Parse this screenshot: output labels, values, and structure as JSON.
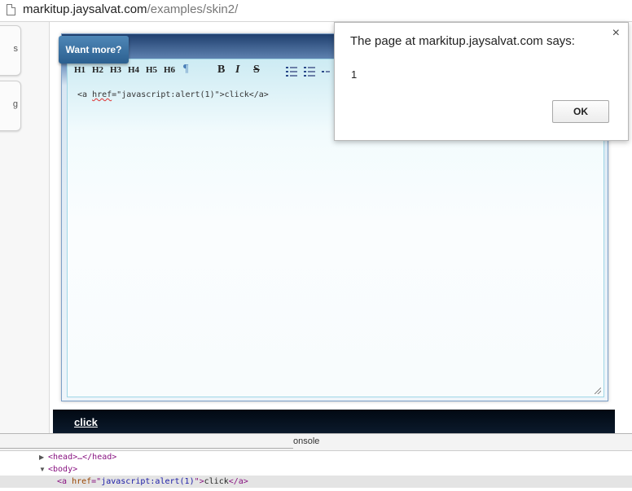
{
  "browser": {
    "url_host": "markitup.jaysalvat.com",
    "url_path": "/examples/skin2/"
  },
  "left_panel": {
    "tab1_glyph": "s",
    "tab2_glyph": "g"
  },
  "editor": {
    "want_more_label": "Want more?",
    "toolbar": {
      "h1": "H1",
      "h2": "H2",
      "h3": "H3",
      "h4": "H4",
      "h5": "H5",
      "h6": "H6",
      "paragraph": "¶",
      "bold": "B",
      "italic": "I",
      "strike": "S"
    },
    "content_prefix": "<a ",
    "content_attr": "href",
    "content_rest": "=\"javascript:alert(1)\">click</a>"
  },
  "preview": {
    "link_text": "click"
  },
  "dialog": {
    "title": "The page at markitup.jaysalvat.com says:",
    "close_glyph": "×",
    "message": "1",
    "ok_label": "OK"
  },
  "devtools": {
    "console_tab": "onsole",
    "head_line": "<head>…</head>",
    "body_line": "<body>",
    "a_open": "<a ",
    "a_attr": "href",
    "a_eq": "=\"",
    "a_val": "javascript:alert(1)",
    "a_close_q": "\">",
    "a_text": "click",
    "a_end": "</a>"
  },
  "colors": {
    "accent": "#2b5f8f",
    "preview_bg": "#020913"
  }
}
